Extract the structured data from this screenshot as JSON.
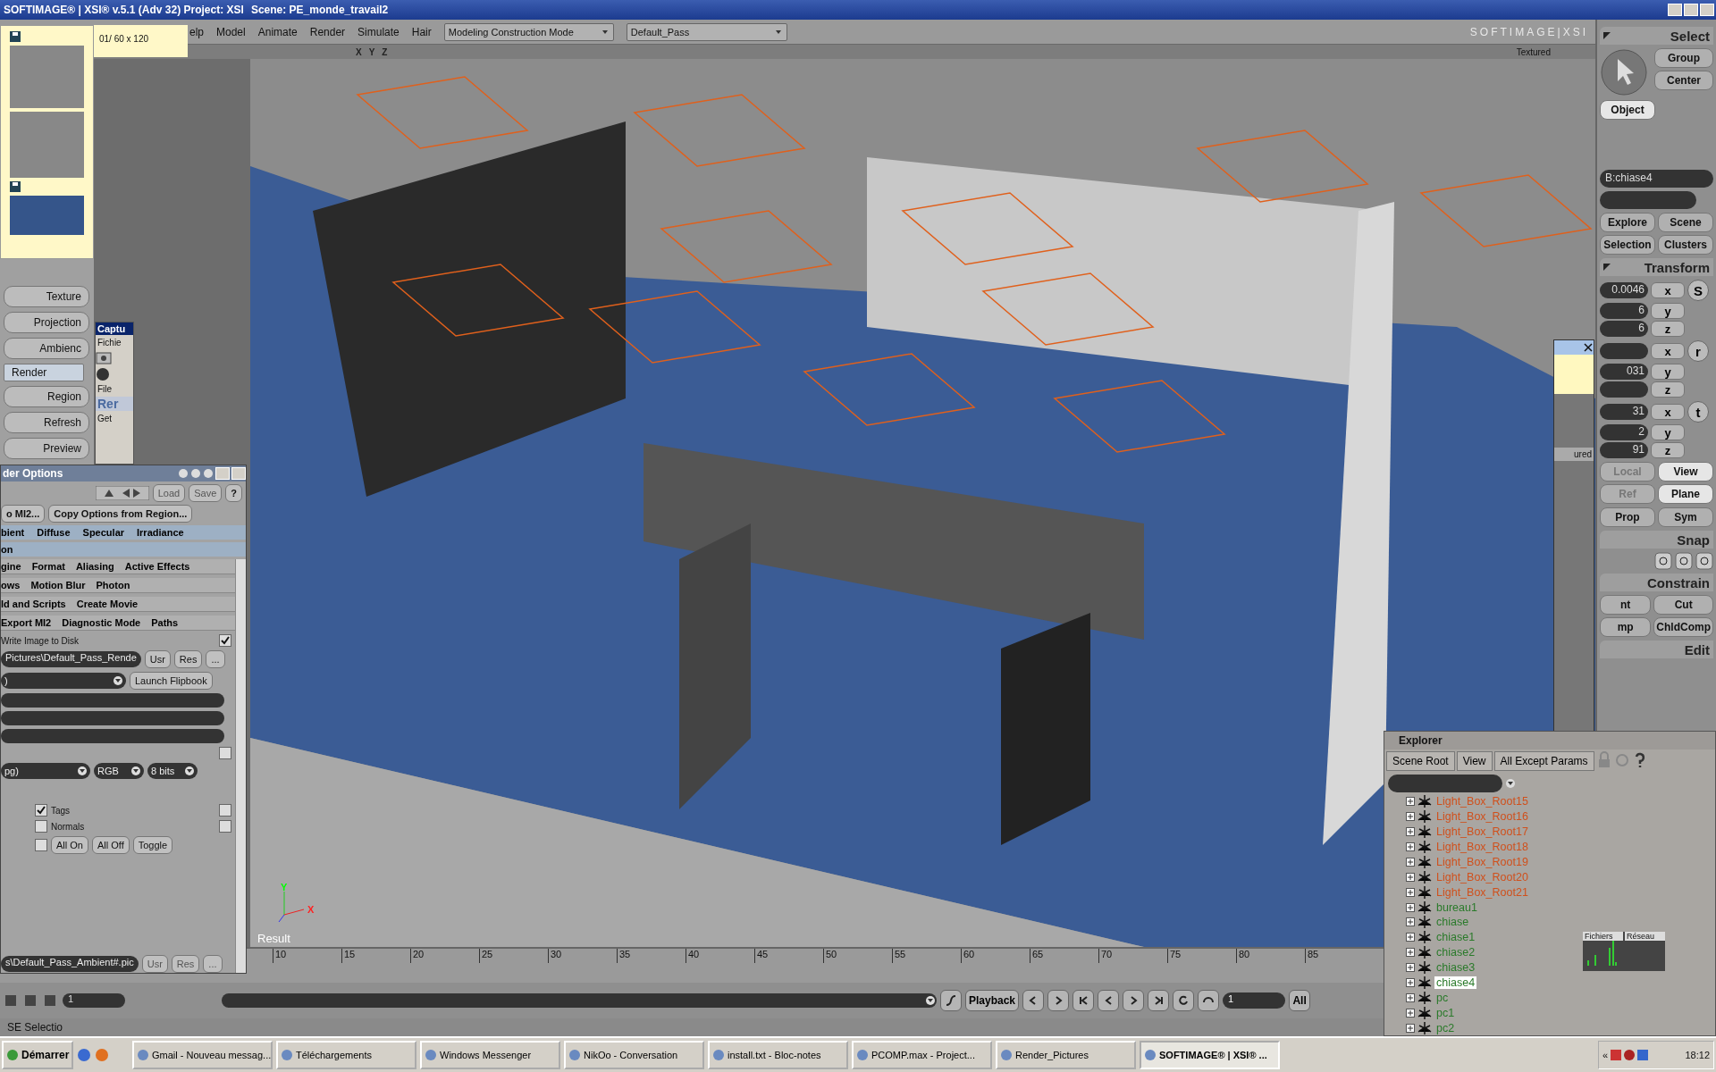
{
  "title_bar": {
    "title": "SOFTIMAGE® | XSI® v.5.1 (Adv 32) Project: XSI",
    "scene": "Scene: PE_monde_travail2"
  },
  "menu_bar": {
    "items": [
      "elp",
      "Model",
      "Animate",
      "Render",
      "Simulate",
      "Hair"
    ],
    "mode_dropdown": "Modeling Construction Mode",
    "pass_dropdown": "Default_Pass",
    "logo": "SOFTIMAGE|XSI"
  },
  "viewport": {
    "axes": [
      "X",
      "Y",
      "Z"
    ],
    "display_mode": "Textured",
    "label": "Result",
    "gizmo_labels": [
      "Y",
      "X"
    ]
  },
  "capture_viewer": {
    "frame_info": "01/ 60 x 120"
  },
  "left_buttons": [
    {
      "label": "Texture",
      "selected": false
    },
    {
      "label": "Projection",
      "selected": false
    },
    {
      "label": "Ambienc",
      "selected": false
    },
    {
      "label": "Render",
      "selected": true
    },
    {
      "label": "Region",
      "selected": false
    },
    {
      "label": "Refresh",
      "selected": false
    },
    {
      "label": "Preview",
      "selected": false
    }
  ],
  "capture_dialog": {
    "title": "Captu",
    "menu": "Fichie"
  },
  "xsi_dialog": {
    "menu": "File",
    "header": "Rer",
    "button": "Get"
  },
  "render_options": {
    "title": "der Options",
    "load": "Load",
    "save": "Save",
    "help": "?",
    "buttons": [
      "o MI2...",
      "Copy Options from Region..."
    ],
    "section_tabs": [
      [
        "bient",
        "Diffuse",
        "Specular",
        "Irradiance"
      ],
      [
        "on"
      ]
    ],
    "page_tabs": [
      [
        "gine",
        "Format",
        "Aliasing",
        "Active Effects"
      ],
      [
        "ows",
        "Motion Blur",
        "Photon"
      ],
      [
        "ld and Scripts",
        "Create Movie"
      ],
      [
        "Export MI2",
        "Diagnostic Mode",
        "Paths"
      ]
    ],
    "write_image": {
      "label": "Write Image to Disk",
      "checked": true
    },
    "output_path": "Pictures\\Default_Pass_Rende",
    "usr": "Usr",
    "res": "Res",
    "more": "...",
    "dropdown": ")",
    "launch": "Launch Flipbook",
    "extra_checkbox": {
      "checked": false
    },
    "format_dropdown": "pg)",
    "channels_dropdown": "RGB",
    "depth_dropdown": "8 bits",
    "toggles": [
      {
        "label": "Tags",
        "checked": true,
        "side_checked": false
      },
      {
        "label": "Normals",
        "checked": false,
        "side_checked": false
      }
    ],
    "all_checkbox": {
      "checked": false
    },
    "all_buttons": [
      "All On",
      "All Off",
      "Toggle"
    ],
    "ambient_path": "s\\Default_Pass_Ambient#.pic",
    "ambient_usr": "Usr",
    "ambient_res": "Res",
    "ambient_more": "..."
  },
  "right_panel": {
    "select_title": "Select",
    "select_buttons": [
      "Group",
      "Center"
    ],
    "object": {
      "label": "Object",
      "selected": true
    },
    "selection_field": "B:chiase4",
    "nav_buttons": [
      "Explore",
      "Scene",
      "Selection",
      "Clusters"
    ],
    "transform_title": "Transform",
    "transform_groups": [
      {
        "symbol": "S",
        "rows": [
          {
            "axis": "x",
            "value": "0.0046"
          },
          {
            "axis": "y",
            "value": "6"
          },
          {
            "axis": "z",
            "value": "6"
          }
        ]
      },
      {
        "symbol": "r",
        "rows": [
          {
            "axis": "x"
          },
          {
            "axis": "y",
            "value": "031"
          },
          {
            "axis": "z"
          }
        ]
      },
      {
        "symbol": "t",
        "rows": [
          {
            "axis": "x",
            "value": "31"
          },
          {
            "axis": "y",
            "value": "2"
          },
          {
            "axis": "z",
            "value": "91"
          }
        ]
      }
    ],
    "space_buttons": [
      {
        "label": "Local",
        "disabled": true
      },
      {
        "label": "View",
        "disabled": false
      },
      {
        "label": "Ref",
        "disabled": true
      },
      {
        "label": "Plane",
        "disabled": false
      }
    ],
    "prop": "Prop",
    "sym": "Sym",
    "snap_title": "Snap",
    "constrain_title": "Constrain",
    "constrain_buttons": [
      "nt",
      "Cut",
      "mp",
      "ChldComp"
    ],
    "edit_title": "Edit",
    "overlay_fragment": "ured"
  },
  "explorer": {
    "title": "Explorer",
    "toolbar": [
      "Scene Root",
      "View",
      "All Except Params"
    ],
    "items": [
      {
        "label": "Light_Box_Root15",
        "color": "#d0501c",
        "selected": false
      },
      {
        "label": "Light_Box_Root16",
        "color": "#d0501c",
        "selected": false
      },
      {
        "label": "Light_Box_Root17",
        "color": "#d0501c",
        "selected": false
      },
      {
        "label": "Light_Box_Root18",
        "color": "#d0501c",
        "selected": false
      },
      {
        "label": "Light_Box_Root19",
        "color": "#d0501c",
        "selected": false
      },
      {
        "label": "Light_Box_Root20",
        "color": "#d0501c",
        "selected": false
      },
      {
        "label": "Light_Box_Root21",
        "color": "#d0501c",
        "selected": false
      },
      {
        "label": "bureau1",
        "color": "#2a7a2a",
        "selected": false
      },
      {
        "label": "chiase",
        "color": "#2a7a2a",
        "selected": false
      },
      {
        "label": "chiase1",
        "color": "#2a7a2a",
        "selected": false
      },
      {
        "label": "chiase2",
        "color": "#2a7a2a",
        "selected": false
      },
      {
        "label": "chiase3",
        "color": "#2a7a2a",
        "selected": false
      },
      {
        "label": "chiase4",
        "color": "#2a7a2a",
        "selected": true
      },
      {
        "label": "pc",
        "color": "#2a7a2a",
        "selected": false
      },
      {
        "label": "pc1",
        "color": "#2a7a2a",
        "selected": false
      },
      {
        "label": "pc2",
        "color": "#2a7a2a",
        "selected": false
      }
    ],
    "monitor_tabs": [
      "Fichiers",
      "Réseau"
    ]
  },
  "timeline": {
    "ticks": [
      "10",
      "15",
      "20",
      "25",
      "30",
      "35",
      "40",
      "45",
      "50",
      "55",
      "60",
      "65",
      "70",
      "75",
      "80",
      "85"
    ]
  },
  "playback": {
    "frame_field": "1",
    "button": "Playback",
    "current_frame": "1",
    "all": "All"
  },
  "status": {
    "text": "SE Selectio"
  },
  "taskbar": {
    "start": "Démarrer",
    "items": [
      {
        "label": "Gmail - Nouveau messag...",
        "selected": false
      },
      {
        "label": "Téléchargements",
        "selected": false
      },
      {
        "label": "Windows Messenger",
        "selected": false
      },
      {
        "label": "NikOo - Conversation",
        "selected": false
      },
      {
        "label": "install.txt - Bloc-notes",
        "selected": false
      },
      {
        "label": "PCOMP.max     - Project...",
        "selected": false
      },
      {
        "label": "Render_Pictures",
        "selected": false
      },
      {
        "label": "SOFTIMAGE® | XSI® ...",
        "selected": true
      }
    ],
    "tray_toggle": "«",
    "clock": "18:12"
  }
}
